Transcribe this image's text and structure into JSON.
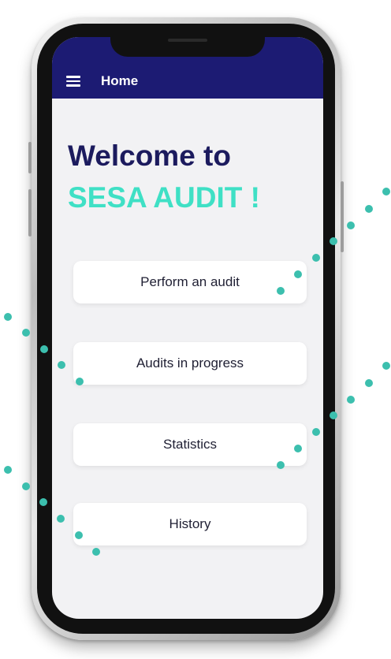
{
  "app_bar": {
    "title": "Home",
    "menu_icon": "hamburger-menu-icon"
  },
  "welcome": {
    "line1": "Welcome to",
    "line2": "SESA AUDIT !"
  },
  "menu": {
    "items": [
      {
        "label": "Perform an audit"
      },
      {
        "label": "Audits in progress"
      },
      {
        "label": "Statistics"
      },
      {
        "label": "History"
      }
    ]
  },
  "colors": {
    "app_bar": "#1c1b73",
    "title_primary": "#1c1b5e",
    "title_accent": "#3fe0c5",
    "dot": "#3cbfae",
    "screen_background": "#f2f2f4",
    "button_background": "#ffffff"
  }
}
